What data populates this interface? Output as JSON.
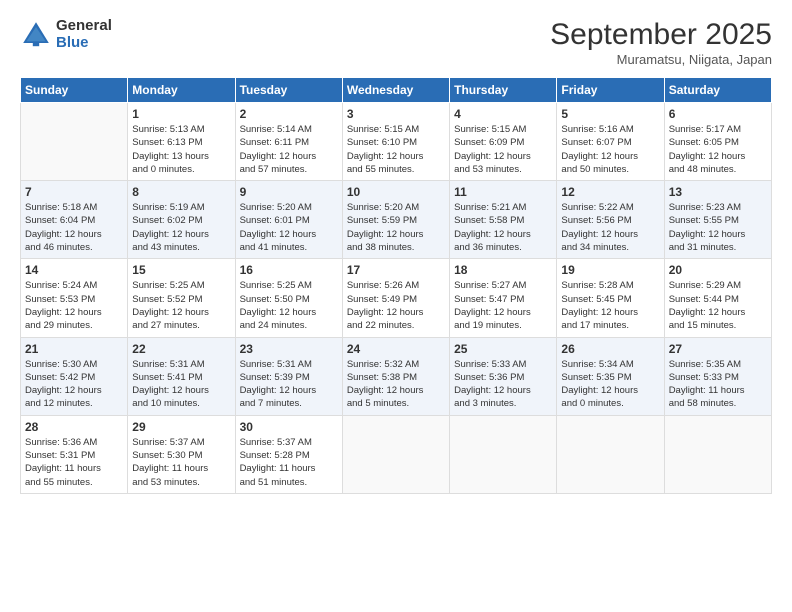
{
  "logo": {
    "general": "General",
    "blue": "Blue"
  },
  "title": "September 2025",
  "location": "Muramatsu, Niigata, Japan",
  "days_of_week": [
    "Sunday",
    "Monday",
    "Tuesday",
    "Wednesday",
    "Thursday",
    "Friday",
    "Saturday"
  ],
  "weeks": [
    [
      {
        "day": "",
        "info": ""
      },
      {
        "day": "1",
        "info": "Sunrise: 5:13 AM\nSunset: 6:13 PM\nDaylight: 13 hours\nand 0 minutes."
      },
      {
        "day": "2",
        "info": "Sunrise: 5:14 AM\nSunset: 6:11 PM\nDaylight: 12 hours\nand 57 minutes."
      },
      {
        "day": "3",
        "info": "Sunrise: 5:15 AM\nSunset: 6:10 PM\nDaylight: 12 hours\nand 55 minutes."
      },
      {
        "day": "4",
        "info": "Sunrise: 5:15 AM\nSunset: 6:09 PM\nDaylight: 12 hours\nand 53 minutes."
      },
      {
        "day": "5",
        "info": "Sunrise: 5:16 AM\nSunset: 6:07 PM\nDaylight: 12 hours\nand 50 minutes."
      },
      {
        "day": "6",
        "info": "Sunrise: 5:17 AM\nSunset: 6:05 PM\nDaylight: 12 hours\nand 48 minutes."
      }
    ],
    [
      {
        "day": "7",
        "info": "Sunrise: 5:18 AM\nSunset: 6:04 PM\nDaylight: 12 hours\nand 46 minutes."
      },
      {
        "day": "8",
        "info": "Sunrise: 5:19 AM\nSunset: 6:02 PM\nDaylight: 12 hours\nand 43 minutes."
      },
      {
        "day": "9",
        "info": "Sunrise: 5:20 AM\nSunset: 6:01 PM\nDaylight: 12 hours\nand 41 minutes."
      },
      {
        "day": "10",
        "info": "Sunrise: 5:20 AM\nSunset: 5:59 PM\nDaylight: 12 hours\nand 38 minutes."
      },
      {
        "day": "11",
        "info": "Sunrise: 5:21 AM\nSunset: 5:58 PM\nDaylight: 12 hours\nand 36 minutes."
      },
      {
        "day": "12",
        "info": "Sunrise: 5:22 AM\nSunset: 5:56 PM\nDaylight: 12 hours\nand 34 minutes."
      },
      {
        "day": "13",
        "info": "Sunrise: 5:23 AM\nSunset: 5:55 PM\nDaylight: 12 hours\nand 31 minutes."
      }
    ],
    [
      {
        "day": "14",
        "info": "Sunrise: 5:24 AM\nSunset: 5:53 PM\nDaylight: 12 hours\nand 29 minutes."
      },
      {
        "day": "15",
        "info": "Sunrise: 5:25 AM\nSunset: 5:52 PM\nDaylight: 12 hours\nand 27 minutes."
      },
      {
        "day": "16",
        "info": "Sunrise: 5:25 AM\nSunset: 5:50 PM\nDaylight: 12 hours\nand 24 minutes."
      },
      {
        "day": "17",
        "info": "Sunrise: 5:26 AM\nSunset: 5:49 PM\nDaylight: 12 hours\nand 22 minutes."
      },
      {
        "day": "18",
        "info": "Sunrise: 5:27 AM\nSunset: 5:47 PM\nDaylight: 12 hours\nand 19 minutes."
      },
      {
        "day": "19",
        "info": "Sunrise: 5:28 AM\nSunset: 5:45 PM\nDaylight: 12 hours\nand 17 minutes."
      },
      {
        "day": "20",
        "info": "Sunrise: 5:29 AM\nSunset: 5:44 PM\nDaylight: 12 hours\nand 15 minutes."
      }
    ],
    [
      {
        "day": "21",
        "info": "Sunrise: 5:30 AM\nSunset: 5:42 PM\nDaylight: 12 hours\nand 12 minutes."
      },
      {
        "day": "22",
        "info": "Sunrise: 5:31 AM\nSunset: 5:41 PM\nDaylight: 12 hours\nand 10 minutes."
      },
      {
        "day": "23",
        "info": "Sunrise: 5:31 AM\nSunset: 5:39 PM\nDaylight: 12 hours\nand 7 minutes."
      },
      {
        "day": "24",
        "info": "Sunrise: 5:32 AM\nSunset: 5:38 PM\nDaylight: 12 hours\nand 5 minutes."
      },
      {
        "day": "25",
        "info": "Sunrise: 5:33 AM\nSunset: 5:36 PM\nDaylight: 12 hours\nand 3 minutes."
      },
      {
        "day": "26",
        "info": "Sunrise: 5:34 AM\nSunset: 5:35 PM\nDaylight: 12 hours\nand 0 minutes."
      },
      {
        "day": "27",
        "info": "Sunrise: 5:35 AM\nSunset: 5:33 PM\nDaylight: 11 hours\nand 58 minutes."
      }
    ],
    [
      {
        "day": "28",
        "info": "Sunrise: 5:36 AM\nSunset: 5:31 PM\nDaylight: 11 hours\nand 55 minutes."
      },
      {
        "day": "29",
        "info": "Sunrise: 5:37 AM\nSunset: 5:30 PM\nDaylight: 11 hours\nand 53 minutes."
      },
      {
        "day": "30",
        "info": "Sunrise: 5:37 AM\nSunset: 5:28 PM\nDaylight: 11 hours\nand 51 minutes."
      },
      {
        "day": "",
        "info": ""
      },
      {
        "day": "",
        "info": ""
      },
      {
        "day": "",
        "info": ""
      },
      {
        "day": "",
        "info": ""
      }
    ]
  ]
}
